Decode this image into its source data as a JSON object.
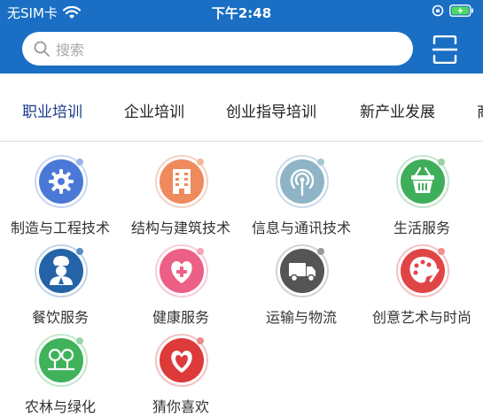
{
  "status": {
    "carrier": "无SIM卡",
    "time": "下午2:48"
  },
  "search": {
    "placeholder": "搜索"
  },
  "tabs": [
    "职业培训",
    "企业培训",
    "创业指导培训",
    "新产业发展",
    "商"
  ],
  "categories": [
    {
      "label": "制造与工程技术",
      "icon": "gear-wrench-icon",
      "color": "#4a78d6"
    },
    {
      "label": "结构与建筑技术",
      "icon": "building-icon",
      "color": "#ee8a5c"
    },
    {
      "label": "信息与通讯技术",
      "icon": "antenna-icon",
      "color": "#4fa2c8"
    },
    {
      "label": "生活服务",
      "icon": "shopping-basket-icon",
      "color": "#3fae5a"
    },
    {
      "label": "餐饮服务",
      "icon": "chef-icon",
      "color": "#2563a8"
    },
    {
      "label": "健康服务",
      "icon": "heart-plus-icon",
      "color": "#ec5f86"
    },
    {
      "label": "运输与物流",
      "icon": "truck-icon",
      "color": "#555555"
    },
    {
      "label": "创意艺术与时尚",
      "icon": "palette-icon",
      "color": "#e04545"
    },
    {
      "label": "农林与绿化",
      "icon": "trees-icon",
      "color": "#3fb25a"
    },
    {
      "label": "猜你喜欢",
      "icon": "double-heart-icon",
      "color": "#dd3a3a"
    }
  ],
  "colors": {
    "header": "#1a6fc4",
    "active_tab": "#1a3a8a"
  }
}
